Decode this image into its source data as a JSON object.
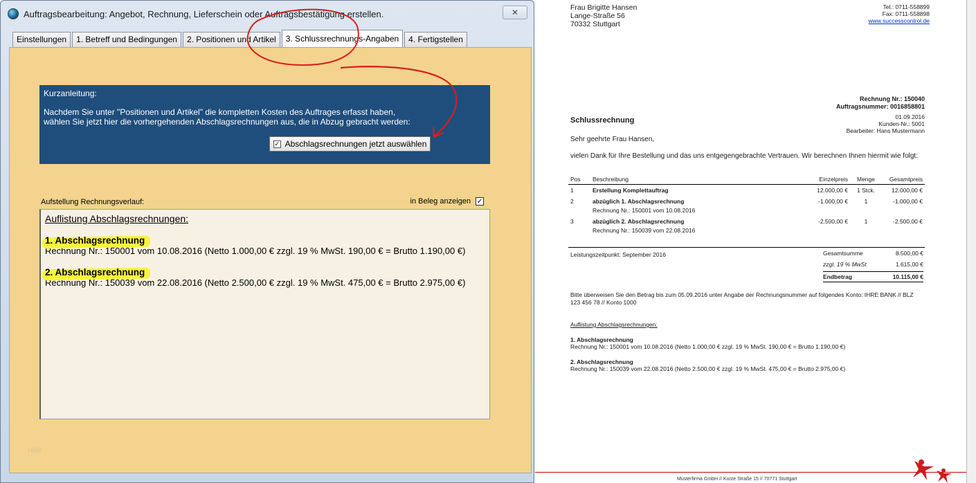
{
  "window": {
    "title": "Auftragsbearbeitung: Angebot, Rechnung, Lieferschein oder Auftragsbestätigung erstellen.",
    "close_label": "✕"
  },
  "tabs": [
    {
      "label": "Einstellungen"
    },
    {
      "label": "1. Betreff und Bedingungen"
    },
    {
      "label": "2. Positionen und Artikel"
    },
    {
      "label": "3. Schlussrechnungs-Angaben",
      "active": true
    },
    {
      "label": "4. Fertigstellen"
    }
  ],
  "quick_guide": {
    "title": "Kurzanleitung:",
    "line1": "Nachdem Sie unter \"Positionen und Artikel\" die kompletten Kosten des Auftrages erfasst haben,",
    "line2": "wählen Sie jetzt hier die vorhergehenden Abschlagsrechnungen aus, die in Abzug gebracht werden:",
    "button_label": "Abschlagsrechnungen jetzt auswählen"
  },
  "history": {
    "label": "Aufstellung Rechnungsverlauf:",
    "show_in_doc_label": "in Beleg anzeigen",
    "show_in_doc_checked": true,
    "heading": "Auflistung Abschlagsrechnungen:",
    "items": [
      {
        "title": "1. Abschlagsrechnung",
        "line": "Rechnung Nr.: 150001 vom 10.08.2016 (Netto 1.000,00 €  zzgl. 19 % MwSt. 190,00 € = Brutto 1.190,00 €)"
      },
      {
        "title": "2. Abschlagsrechnung",
        "line": "Rechnung Nr.: 150039 vom 22.08.2016 (Netto 2.500,00 €  zzgl. 19 % MwSt. 475,00 € = Brutto 2.975,00 €)"
      }
    ]
  },
  "faint_label": "Hilfe",
  "document": {
    "addr": [
      "Frau Brigitte Hansen",
      "Lange-Straße 56",
      "70332 Stuttgart"
    ],
    "contact": [
      "Tel.: 0711-558899",
      "Fax: 0711-558898",
      "www.successcontrol.de"
    ],
    "invoice_no": "Rechnung Nr.: 150040",
    "order_no": "Auftragsnummer: 0016858801",
    "date": "01.09.2016",
    "customer_no": "Kunden-Nr.: 5001",
    "agent": "Bearbeiter: Hans Mustermann",
    "heading": "Schlussrechnung",
    "greeting": "Sehr geehrte Frau Hansen,",
    "intro": "vielen Dank für Ihre Bestellung und das uns entgegengebrachte Vertrauen. Wir berechnen Ihnen hiermit wie folgt:",
    "columns": [
      "Pos",
      "Beschreibung",
      "Einzelpreis",
      "Menge",
      "Gesamtpreis"
    ],
    "rows": [
      {
        "pos": "1",
        "desc": "Erstellung Komplettauftrag",
        "sub": "",
        "price": "12.000,00 €",
        "qty": "1 Stck.",
        "total": "12.000,00 €"
      },
      {
        "pos": "2",
        "desc": "abzüglich 1. Abschlagsrechnung",
        "sub": "Rechnung Nr.: 150001 vom 10.08.2016",
        "price": "-1.000,00 €",
        "qty": "1",
        "total": "-1.000,00 €"
      },
      {
        "pos": "3",
        "desc": "abzüglich 2. Abschlagsrechnung",
        "sub": "Rechnung Nr.: 150039 vom 22.08.2016",
        "price": "-2.500,00 €",
        "qty": "1",
        "total": "-2.500,00 €"
      }
    ],
    "service_period": "Leistungszeitpunkt: September 2016",
    "sum_label": "Gesamtsumme",
    "sum_value": "8.500,00 €",
    "vat_label": "zzgl. 19 % MwSt",
    "vat_value": "1.615,00 €",
    "end_label": "Endbetrag",
    "end_value": "10.115,00 €",
    "payment_text": "Bitte überweisen Sie den Betrag bis zum 05.09.2016 unter Angabe der Rechnungsnummer auf folgendes Konto: IHRE BANK // BLZ 123 456 78 // Konto 1000",
    "list_heading": "Auflistung Abschlagsrechnungen:",
    "entries": [
      {
        "title": "1. Abschlagsrechnung",
        "line": "Rechnung Nr.: 150001 vom 10.08.2016 (Netto 1.000,00 € zzgl. 19 % MwSt. 190,00 € = Brutto 1.190,00 €)"
      },
      {
        "title": "2. Abschlagsrechnung",
        "line": "Rechnung Nr.: 150039 vom 22.08.2016 (Netto 2.500,00 € zzgl. 19 % MwSt. 475,00 € = Brutto 2.975,00 €)"
      }
    ],
    "footer": "Musterfirma GmbH // Kurze Straße 15 // 70771 Stuttgart"
  },
  "colors": {
    "panel_bg": "#f3d38d",
    "guide_bg": "#1f4e7d",
    "highlight": "#f7f538",
    "annotation": "#d81e1e"
  }
}
